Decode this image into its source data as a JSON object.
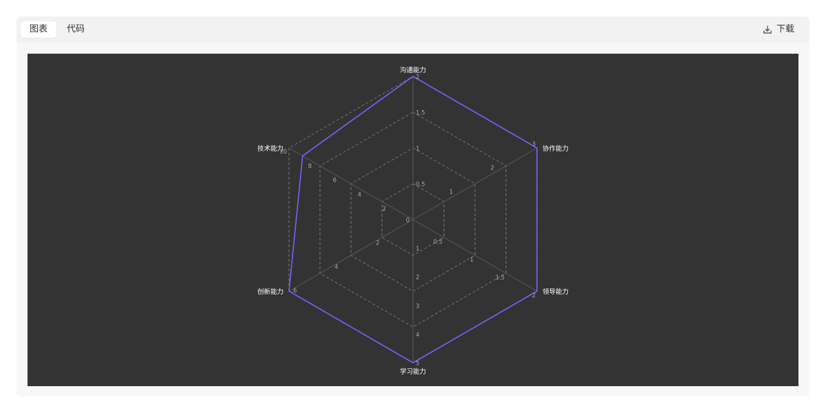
{
  "toolbar": {
    "tabs": [
      {
        "label": "图表",
        "active": true
      },
      {
        "label": "代码",
        "active": false
      }
    ],
    "download_label": "下载",
    "download_icon": "download-icon"
  },
  "colors": {
    "chart_background": "#333333",
    "series": "#7b61ff",
    "grid": "#8a8a8a"
  },
  "chart_data": {
    "type": "radar",
    "indicators": [
      {
        "name": "沟通能力",
        "max": 2,
        "ticks": [
          "0.5",
          "1",
          "1.5",
          "2"
        ]
      },
      {
        "name": "协作能力",
        "max": 3,
        "ticks": [
          "1",
          "2",
          "3"
        ]
      },
      {
        "name": "领导能力",
        "max": 2,
        "ticks": [
          "0.5",
          "1",
          "1.5",
          "2"
        ]
      },
      {
        "name": "学习能力",
        "max": 5,
        "ticks": [
          "1",
          "2",
          "3",
          "4",
          "5"
        ]
      },
      {
        "name": "创新能力",
        "max": 6,
        "ticks": [
          "2",
          "4",
          "6"
        ]
      },
      {
        "name": "技术能力",
        "max": 10,
        "ticks": [
          "2",
          "4",
          "6",
          "8",
          "10"
        ]
      }
    ],
    "center_tick": "0",
    "grid_rings": 4,
    "series": [
      {
        "values": [
          2,
          3,
          2,
          5,
          6,
          8.9
        ]
      }
    ]
  }
}
